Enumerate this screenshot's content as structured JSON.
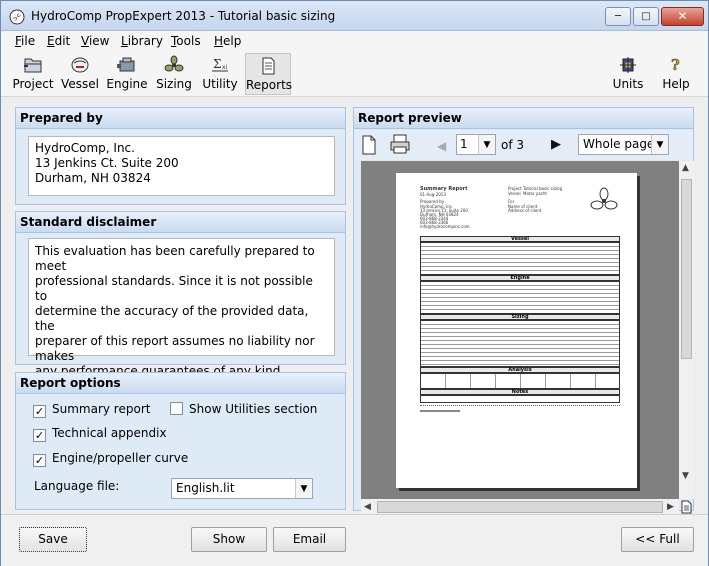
{
  "window": {
    "title": "HydroComp PropExpert 2013 - Tutorial basic sizing"
  },
  "menu": [
    "File",
    "Edit",
    "View",
    "Library",
    "Tools",
    "Help"
  ],
  "toolbar": {
    "left": [
      {
        "label": "Project",
        "icon": "project-icon"
      },
      {
        "label": "Vessel",
        "icon": "vessel-icon"
      },
      {
        "label": "Engine",
        "icon": "engine-icon"
      },
      {
        "label": "Sizing",
        "icon": "sizing-icon"
      },
      {
        "label": "Utility",
        "icon": "utility-icon"
      },
      {
        "label": "Reports",
        "icon": "reports-icon"
      }
    ],
    "right": [
      {
        "label": "Units",
        "icon": "units-icon"
      },
      {
        "label": "Help",
        "icon": "help-icon"
      }
    ]
  },
  "prepared_by": {
    "header": "Prepared by",
    "lines": [
      "HydroComp, Inc.",
      "13 Jenkins Ct. Suite 200",
      "Durham, NH 03824"
    ]
  },
  "disclaimer": {
    "header": "Standard disclaimer",
    "lines": [
      "This evaluation has been carefully prepared to meet",
      "professional standards. Since it is not possible to",
      "determine the accuracy of the provided data, the",
      "preparer of this report assumes no liability nor makes",
      "any performance guarantees of any kind."
    ]
  },
  "report_options": {
    "header": "Report options",
    "summary": {
      "label": "Summary report",
      "checked": true
    },
    "utilities": {
      "label": "Show Utilities section",
      "checked": false
    },
    "appendix": {
      "label": "Technical appendix",
      "checked": true
    },
    "curve": {
      "label": "Engine/propeller curve",
      "checked": true
    },
    "language_label": "Language file:",
    "language_value": "English.lit"
  },
  "report_preview": {
    "header": "Report preview",
    "page_value": "1",
    "of_pages": "of 3",
    "zoom_value": "Whole page",
    "page": {
      "title": "Summary Report",
      "date": "01-Aug-2013",
      "project_label": "Project",
      "project_value": "Tutorial basic sizing",
      "vessel_label": "Vessel",
      "vessel_value": "Motor yacht",
      "for_label": "For",
      "prepared_by_label": "Prepared by",
      "name_label": "Name of client",
      "address_label": "Address of client",
      "prepared_lines": [
        "HydroComp, Inc.",
        "13 Jenkins Ct. Suite 200",
        "Durham, NH 03824",
        "603-868-3344",
        "603-868-3366",
        "info@hydrocompinc.com"
      ],
      "sections": [
        "Vessel",
        "Engine",
        "Sizing",
        "Analysis",
        "Notes"
      ]
    }
  },
  "bottom": {
    "save": "Save",
    "show": "Show",
    "email": "Email",
    "full": "<< Full"
  }
}
